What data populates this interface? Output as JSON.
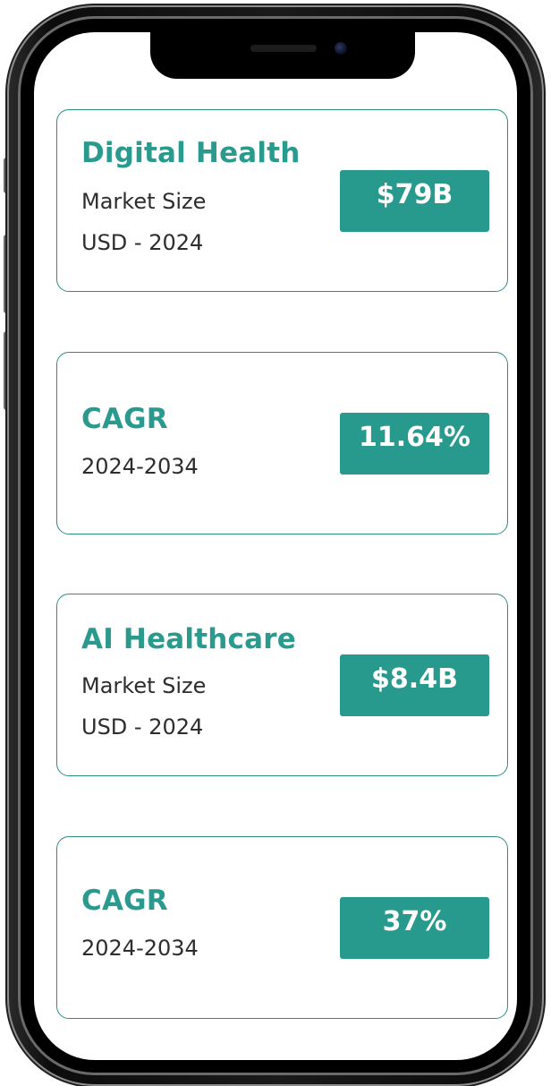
{
  "colors": {
    "accent": "#2a9a8f",
    "badge_bg": "#289a8d",
    "card_border": "#2c8d84",
    "text": "#2d2d2d"
  },
  "cards": [
    {
      "title": "Digital Health",
      "lines": [
        "Market Size",
        "USD - 2024"
      ],
      "value": "$79B"
    },
    {
      "title": "CAGR",
      "lines": [
        "2024-2034"
      ],
      "value": "11.64%"
    },
    {
      "title": "AI Healthcare",
      "lines": [
        "Market Size",
        "USD - 2024"
      ],
      "value": "$8.4B"
    },
    {
      "title": "CAGR",
      "lines": [
        "2024-2034"
      ],
      "value": "37%"
    }
  ]
}
